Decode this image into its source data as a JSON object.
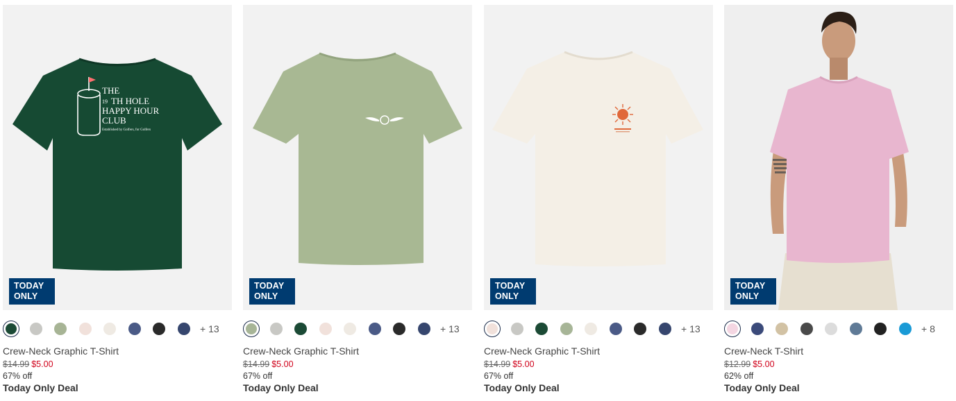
{
  "products": [
    {
      "name": "Crew-Neck Graphic T-Shirt",
      "price_original": "$14.99",
      "price_sale": "$5.00",
      "discount": "67% off",
      "deal": "Today Only Deal",
      "badge": [
        "TODAY",
        "ONLY"
      ],
      "graphic_text": [
        "THE",
        "19",
        "TH HOLE",
        "HAPPY HOUR",
        "CLUB",
        "Established by Golfers, for Golfers"
      ],
      "shirt_color": "#164a33",
      "more_colors": "+ 13",
      "swatches": [
        "#1b4a35",
        "#c8c8c4",
        "#a7b495",
        "#f1e1db",
        "#efeae3",
        "#4a5a86",
        "#2a2a2a",
        "#36466e"
      ]
    },
    {
      "name": "Crew-Neck Graphic T-Shirt",
      "price_original": "$14.99",
      "price_sale": "$5.00",
      "discount": "67% off",
      "deal": "Today Only Deal",
      "badge": [
        "TODAY",
        "ONLY"
      ],
      "graphic_text": [],
      "shirt_color": "#a8b893",
      "more_colors": "+ 13",
      "swatches": [
        "#a7b597",
        "#c8c8c4",
        "#1b4a35",
        "#f1e1db",
        "#efeae3",
        "#4a5a86",
        "#2a2a2a",
        "#36466e"
      ]
    },
    {
      "name": "Crew-Neck Graphic T-Shirt",
      "price_original": "$14.99",
      "price_sale": "$5.00",
      "discount": "67% off",
      "deal": "Today Only Deal",
      "badge": [
        "TODAY",
        "ONLY"
      ],
      "graphic_text": [],
      "shirt_color": "#f4efe6",
      "more_colors": "+ 13",
      "swatches": [
        "#f1e1db",
        "#c8c8c4",
        "#1b4a35",
        "#a7b597",
        "#efeae3",
        "#4a5a86",
        "#2a2a2a",
        "#36466e"
      ]
    },
    {
      "name": "Crew-Neck T-Shirt",
      "price_original": "$12.99",
      "price_sale": "$5.00",
      "discount": "62% off",
      "deal": "Today Only Deal",
      "badge": [
        "TODAY",
        "ONLY"
      ],
      "graphic_text": [],
      "shirt_color": "#e8b6cf",
      "more_colors": "+ 8",
      "swatches": [
        "#f4d6e2",
        "#3b4a7a",
        "#d2c2a4",
        "#4a4a4a",
        "#dcdcdc",
        "#5f7a96",
        "#222222",
        "#1a9ad6"
      ]
    }
  ]
}
